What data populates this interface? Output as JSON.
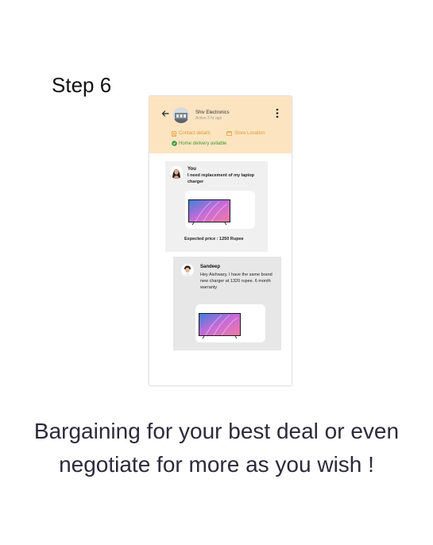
{
  "page": {
    "step_title": "Step 6",
    "caption": "Bargaining for your best deal or even negotiate for more as you wish !"
  },
  "chat": {
    "header": {
      "store_name": "Shiv Electronics",
      "status": "Active 3 hr ago",
      "contact_link": "Contact details",
      "store_link": "Store Location",
      "delivery_text": "Home delivery avilable",
      "colors": {
        "header_bg": "#fde4c1",
        "link": "#d49b2e",
        "delivery": "#3c9b3c"
      }
    },
    "messages": [
      {
        "sender": "You",
        "text": "I need replacement of my laptop charger",
        "footer": "Expected price : 1250 Rupee"
      },
      {
        "sender": "Sandeep",
        "text": "Hey Aishwary, I have the same brand new charger at 1320 rupee. 6 month warranty"
      }
    ]
  },
  "icons": {
    "back": "back-arrow-icon",
    "menu": "more-vertical-icon",
    "contact": "contact-icon",
    "store": "store-icon",
    "delivery": "check-circle-icon",
    "product": "tv-icon"
  }
}
